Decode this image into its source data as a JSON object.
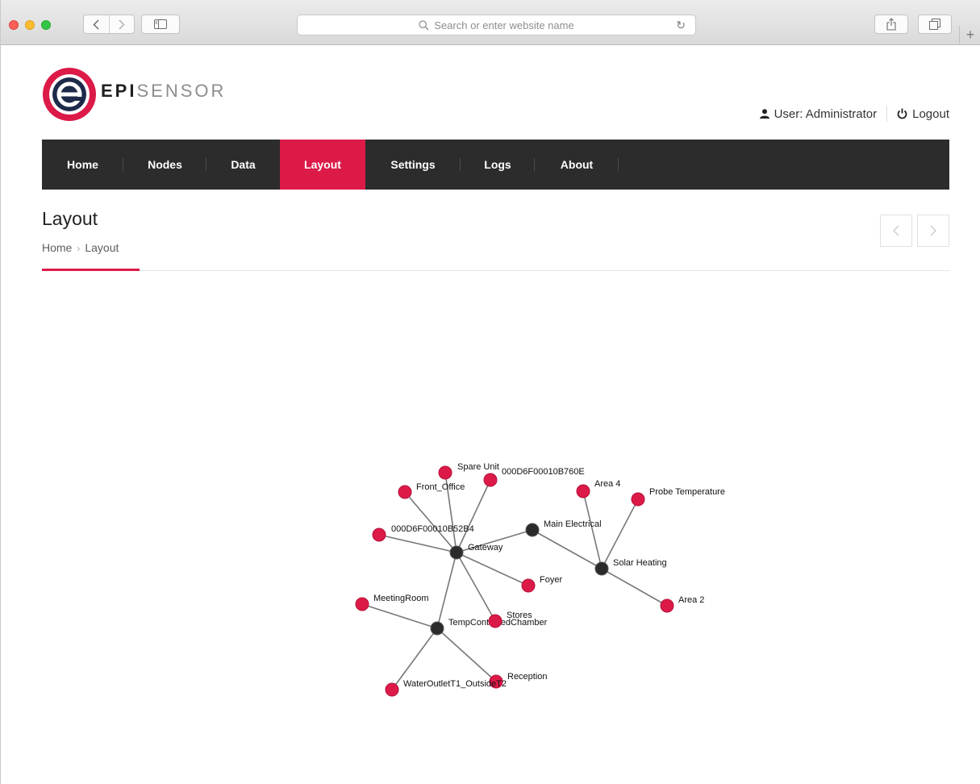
{
  "browser": {
    "url_placeholder": "Search or enter website name"
  },
  "header": {
    "brand_bold": "EPI",
    "brand_light": "SENSOR",
    "user_label": "User: Administrator",
    "logout_label": "Logout"
  },
  "nav": {
    "items": [
      {
        "label": "Home"
      },
      {
        "label": "Nodes"
      },
      {
        "label": "Data"
      },
      {
        "label": "Layout",
        "active": true
      },
      {
        "label": "Settings"
      },
      {
        "label": "Logs"
      },
      {
        "label": "About"
      }
    ]
  },
  "page": {
    "title": "Layout",
    "breadcrumb": [
      "Home",
      "Layout"
    ]
  },
  "colors": {
    "accent": "#dc1a48",
    "nav_bg": "#2c2c2c",
    "hub_node": "#2b2b2b",
    "leaf_node": "#dc1a48"
  },
  "layout_graph": {
    "nodes": [
      {
        "id": "gateway",
        "label": "Gateway",
        "type": "hub"
      },
      {
        "id": "main_electrical",
        "label": "Main Electrical",
        "type": "hub"
      },
      {
        "id": "solar_heating",
        "label": "Solar Heating",
        "type": "hub"
      },
      {
        "id": "temp_chamber",
        "label": "TempControlledChamber",
        "type": "hub"
      },
      {
        "id": "spare_unit",
        "label": "Spare Unit",
        "type": "leaf"
      },
      {
        "id": "n760e",
        "label": "000D6F00010B760E",
        "type": "leaf"
      },
      {
        "id": "front_office",
        "label": "Front_Office",
        "type": "leaf"
      },
      {
        "id": "n52b4",
        "label": "000D6F00010B52B4",
        "type": "leaf"
      },
      {
        "id": "foyer",
        "label": "Foyer",
        "type": "leaf"
      },
      {
        "id": "stores",
        "label": "Stores",
        "type": "leaf"
      },
      {
        "id": "area4",
        "label": "Area 4",
        "type": "leaf"
      },
      {
        "id": "probe_temp",
        "label": "Probe Temperature",
        "type": "leaf"
      },
      {
        "id": "area2",
        "label": "Area 2",
        "type": "leaf"
      },
      {
        "id": "meeting_room",
        "label": "MeetingRoom",
        "type": "leaf"
      },
      {
        "id": "reception",
        "label": "Reception",
        "type": "leaf"
      },
      {
        "id": "water_outlet",
        "label": "WaterOutletT1_OutsideT2",
        "type": "leaf"
      }
    ],
    "links": [
      [
        "gateway",
        "spare_unit"
      ],
      [
        "gateway",
        "n760e"
      ],
      [
        "gateway",
        "front_office"
      ],
      [
        "gateway",
        "n52b4"
      ],
      [
        "gateway",
        "main_electrical"
      ],
      [
        "gateway",
        "foyer"
      ],
      [
        "gateway",
        "stores"
      ],
      [
        "gateway",
        "temp_chamber"
      ],
      [
        "main_electrical",
        "solar_heating"
      ],
      [
        "solar_heating",
        "area4"
      ],
      [
        "solar_heating",
        "probe_temp"
      ],
      [
        "solar_heating",
        "area2"
      ],
      [
        "temp_chamber",
        "meeting_room"
      ],
      [
        "temp_chamber",
        "reception"
      ],
      [
        "temp_chamber",
        "water_outlet"
      ]
    ]
  }
}
